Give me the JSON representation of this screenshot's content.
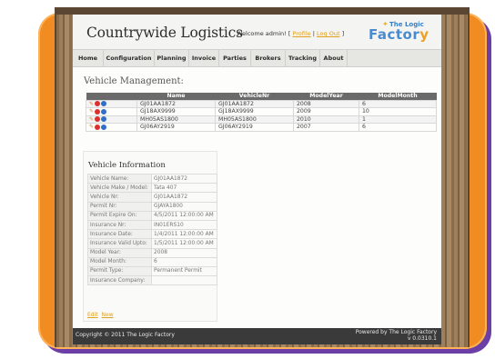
{
  "header": {
    "brand": "Countrywide Logistics",
    "welcome": "Welcome admin! [",
    "profile_link": "Profile",
    "sep": "|",
    "logout_link": "Log Out",
    "welcome_end": "]",
    "logo_top": "The Logic",
    "logo_main_a": "Factor",
    "logo_main_b": "y"
  },
  "nav": [
    "Home",
    "Configuration",
    "Planning",
    "Invoice",
    "Parties",
    "Brokers",
    "Tracking",
    "About"
  ],
  "page_title": "Vehicle Management:",
  "grid": {
    "columns": [
      "",
      "Name",
      "VehicleNr",
      "ModelYear",
      "ModelMonth"
    ],
    "rows": [
      [
        "GJ01AA1872",
        "GJ01AA1872",
        "2008",
        "6"
      ],
      [
        "GJ18AX9999",
        "GJ18AX9999",
        "2009",
        "10"
      ],
      [
        "MH05AS1800",
        "MH05AS1800",
        "2010",
        "1"
      ],
      [
        "GJ06AY2919",
        "GJ06AY2919",
        "2007",
        "6"
      ]
    ]
  },
  "info": {
    "title": "Vehicle Information",
    "fields": [
      [
        "Vehicle Name:",
        "GJ01AA1872"
      ],
      [
        "Vehicle Make / Model:",
        "Tata 407"
      ],
      [
        "Vehicle Nr:",
        "GJ01AA1872"
      ],
      [
        "Permit Nr:",
        "GJAYA1800"
      ],
      [
        "Permit Expire On:",
        "4/5/2011 12:00:00 AM"
      ],
      [
        "Insurance Nr:",
        "IN01ERS10"
      ],
      [
        "Insurance Date:",
        "1/4/2011 12:00:00 AM"
      ],
      [
        "Insurance Valid Upto:",
        "1/5/2011 12:00:00 AM"
      ],
      [
        "Model Year:",
        "2008"
      ],
      [
        "Model Month:",
        "6"
      ],
      [
        "Permit Type:",
        "Permanent Permit"
      ],
      [
        "Insurance Company:",
        ""
      ]
    ],
    "edit_link": "Edit",
    "new_link": "New"
  },
  "footer": {
    "copyright": "Copyright © 2011 The Logic Factory",
    "powered": "Powered by The Logic Factory",
    "version": "v 0.0310.1"
  },
  "colors": {
    "frame_orange": "#f08c22",
    "frame_purple": "#6b3fa6",
    "link": "#e0a020",
    "grid_header": "#6a6a6a",
    "footer_bg": "#3a3a3a"
  },
  "icons": [
    "pencil-icon",
    "delete-icon",
    "info-icon"
  ]
}
